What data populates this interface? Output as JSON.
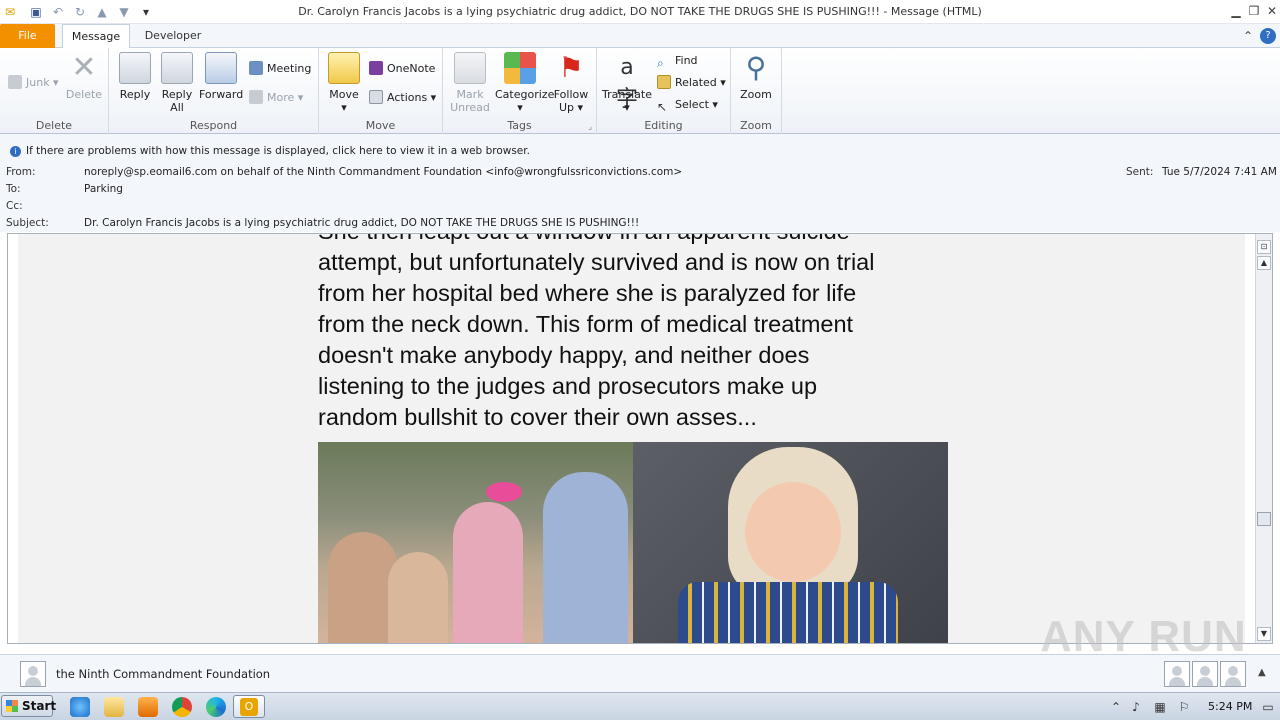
{
  "window": {
    "title": "Dr. Carolyn Francis Jacobs is a lying psychiatric drug addict, DO NOT TAKE THE DRUGS SHE IS PUSHING!!! - Message (HTML)"
  },
  "tabs": [
    {
      "label": "File"
    },
    {
      "label": "Message"
    },
    {
      "label": "Developer"
    }
  ],
  "ribbon": {
    "delete_group": {
      "label": "Delete",
      "junk": "Junk",
      "delete": "Delete"
    },
    "respond_group": {
      "label": "Respond",
      "reply": "Reply",
      "reply_all_1": "Reply",
      "reply_all_2": "All",
      "forward": "Forward",
      "meeting": "Meeting",
      "more": "More"
    },
    "move_group": {
      "label": "Move",
      "move": "Move",
      "onenote": "OneNote",
      "actions": "Actions"
    },
    "tags_group": {
      "label": "Tags",
      "mark_unread_1": "Mark",
      "mark_unread_2": "Unread",
      "categorize": "Categorize",
      "follow_up_1": "Follow",
      "follow_up_2": "Up"
    },
    "editing_group": {
      "label": "Editing",
      "translate": "Translate",
      "find": "Find",
      "related": "Related",
      "select": "Select"
    },
    "zoom_group": {
      "label": "Zoom",
      "zoom": "Zoom"
    }
  },
  "infobar": {
    "message": "If there are problems with how this message is displayed, click here to view it in a web browser."
  },
  "headers": {
    "from_label": "From:",
    "from_value": "noreply@sp.eomail6.com on behalf of the Ninth Commandment Foundation <info@wrongfulssriconvictions.com>",
    "to_label": "To:",
    "to_value": "Parking",
    "cc_label": "Cc:",
    "cc_value": "",
    "subject_label": "Subject:",
    "subject_value": "Dr. Carolyn Francis Jacobs is a lying psychiatric drug addict, DO NOT TAKE THE DRUGS SHE IS PUSHING!!!",
    "sent_label": "Sent:",
    "sent_value": "Tue 5/7/2024 7:41 AM"
  },
  "body": {
    "lines": [
      "She then leapt out a window in an apparent suicide",
      "attempt, but unfortunately survived and is now on trial",
      "from her hospital bed where she is paralyzed for life",
      "from the neck down. This form of medical treatment",
      "doesn't make anybody happy, and neither does",
      "listening to the judges and prosecutors make up",
      "random bullshit to cover their own asses..."
    ]
  },
  "people_pane": {
    "name": "the Ninth Commandment Foundation"
  },
  "taskbar": {
    "start": "Start",
    "clock": "5:24 PM"
  },
  "watermark": "ANY RUN"
}
